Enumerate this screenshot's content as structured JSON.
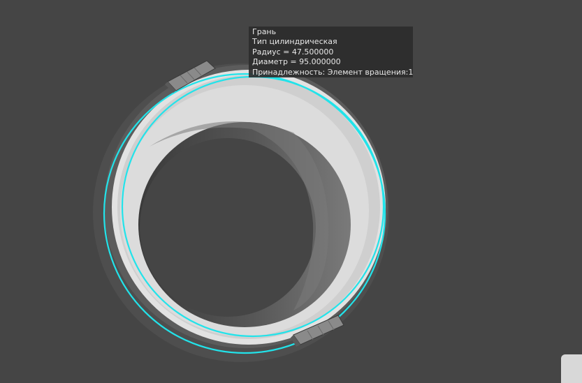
{
  "viewport": {
    "background": "#454545"
  },
  "tooltip": {
    "lines": [
      " Грань",
      "Тип цилиндрическая",
      "Радиус = 47.500000",
      "Диаметр = 95.000000",
      "Принадлежность: Элемент вращения:1"
    ]
  },
  "model": {
    "highlight_color": "#22e3ea",
    "face_color": "#dcdcdc",
    "shadow_color": "#6e6e6e"
  }
}
